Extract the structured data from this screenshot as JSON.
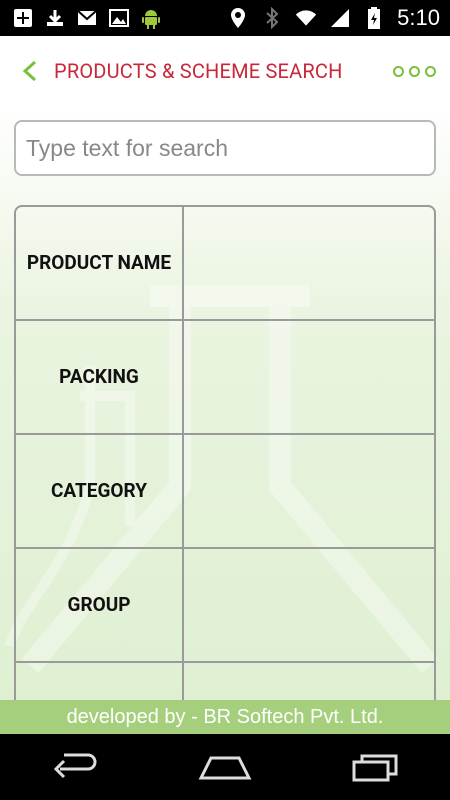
{
  "status_bar": {
    "time": "5:10",
    "left_icons": [
      "add-icon",
      "download-icon",
      "gmail-icon",
      "image-icon",
      "android-icon"
    ],
    "right_icons": [
      "location-icon",
      "bluetooth-icon",
      "wifi-icon",
      "signal-icon",
      "battery-icon"
    ]
  },
  "header": {
    "title": "PRODUCTS & SCHEME SEARCH",
    "back_icon": "chevron-left-icon",
    "menu_icon": "overflow-dots-icon"
  },
  "search": {
    "placeholder": "Type text for search",
    "value": ""
  },
  "details_table": {
    "rows": [
      {
        "label": "PRODUCT NAME",
        "value": ""
      },
      {
        "label": "PACKING",
        "value": ""
      },
      {
        "label": "CATEGORY",
        "value": ""
      },
      {
        "label": "GROUP",
        "value": ""
      },
      {
        "label": "",
        "value": ""
      }
    ]
  },
  "footer": {
    "text": "developed by - BR Softech Pvt. Ltd."
  },
  "nav_bar": {
    "icons": [
      "back-icon",
      "home-icon",
      "recents-icon"
    ]
  },
  "colors": {
    "title": "#c8283a",
    "accent_green": "#79c03a",
    "footer_bg": "#a5cf7c"
  }
}
